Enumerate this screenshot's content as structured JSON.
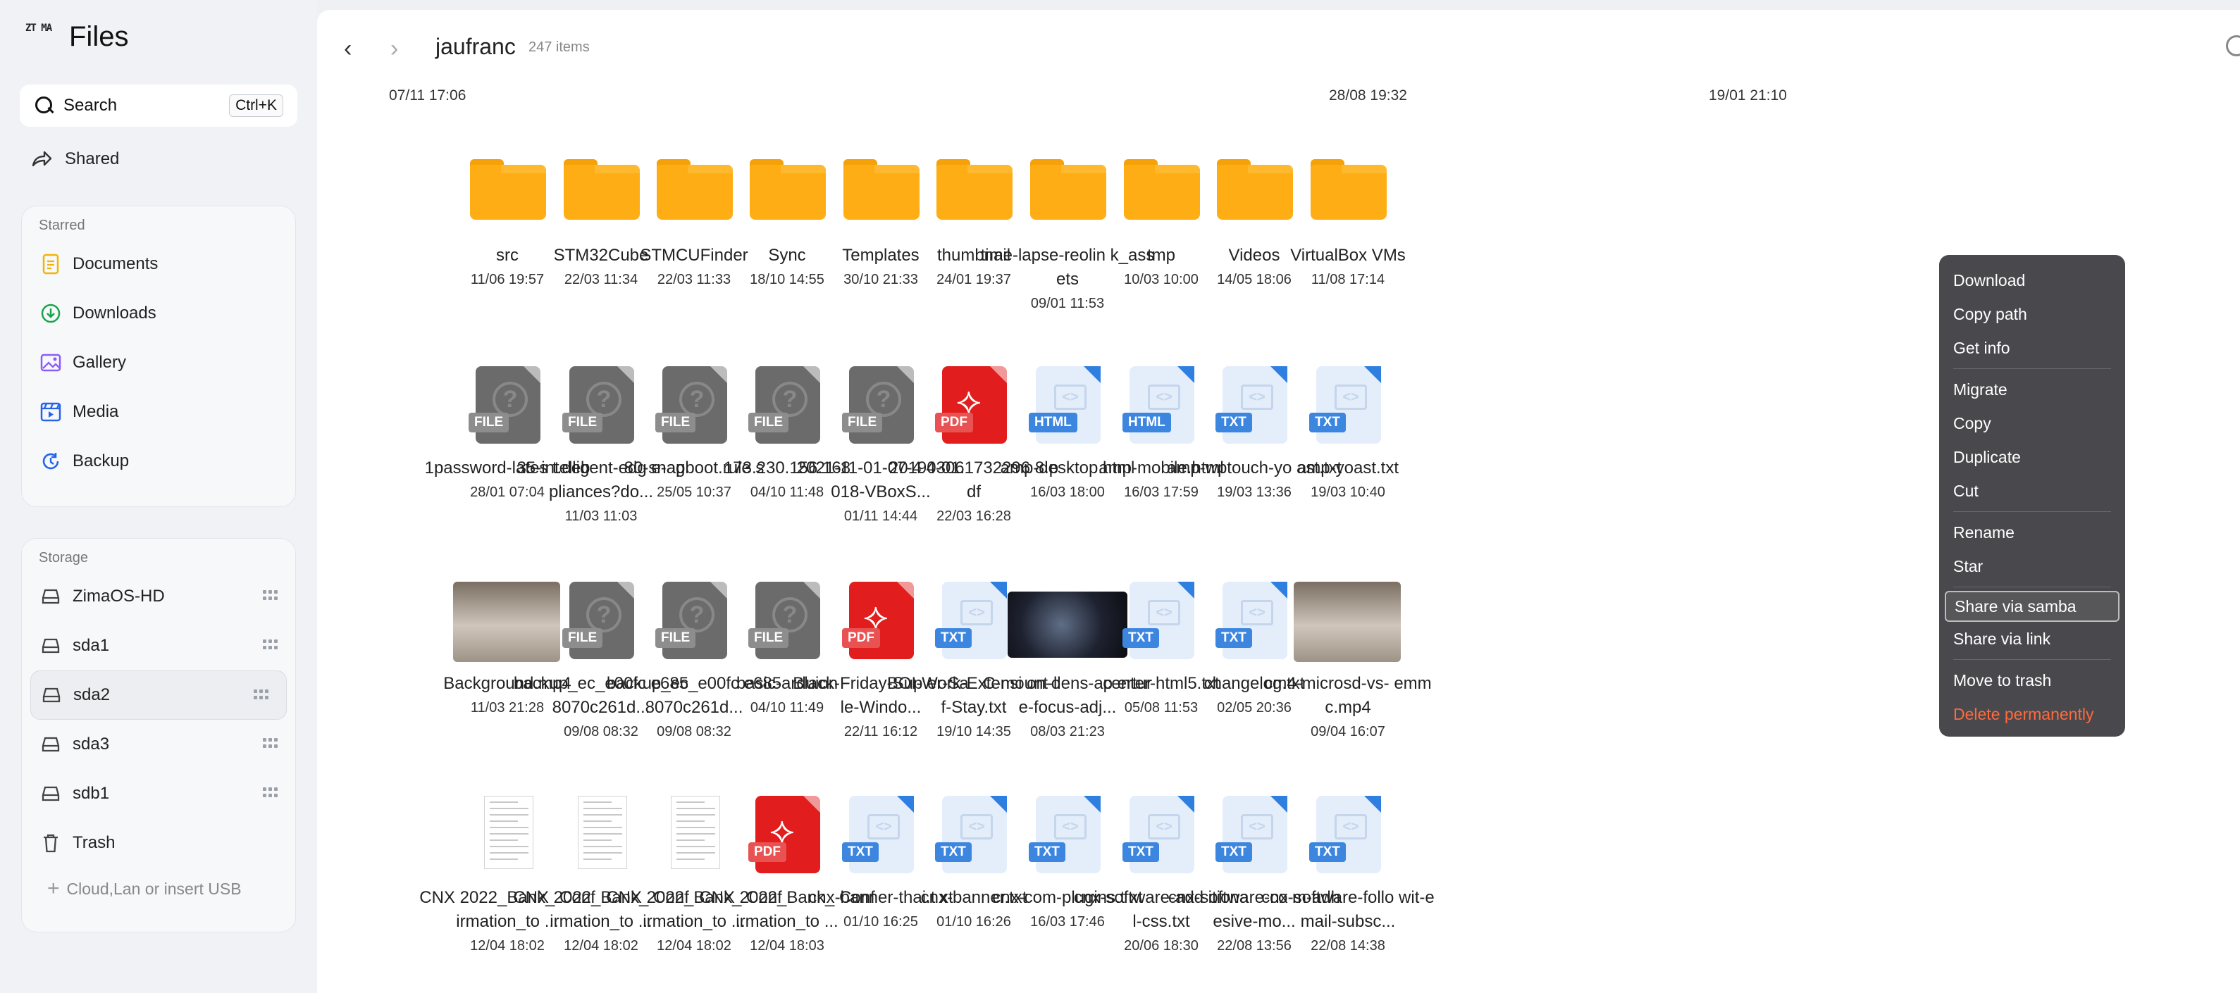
{
  "app": {
    "title": "Files",
    "logo_text": "ZT MA"
  },
  "search": {
    "label": "Search",
    "shortcut": "Ctrl+K"
  },
  "shared": {
    "label": "Shared"
  },
  "starred": {
    "title": "Starred",
    "items": [
      {
        "label": "Documents",
        "icon": "document-icon",
        "color": "#f4b400"
      },
      {
        "label": "Downloads",
        "icon": "download-icon",
        "color": "#1aa34a"
      },
      {
        "label": "Gallery",
        "icon": "image-icon",
        "color": "#8b5cf6"
      },
      {
        "label": "Media",
        "icon": "film-icon",
        "color": "#2563eb"
      },
      {
        "label": "Backup",
        "icon": "backup-icon",
        "color": "#2563eb"
      }
    ]
  },
  "storage": {
    "title": "Storage",
    "items": [
      {
        "label": "ZimaOS-HD"
      },
      {
        "label": "sda1"
      },
      {
        "label": "sda2"
      },
      {
        "label": "sda3"
      },
      {
        "label": "sdb1"
      },
      {
        "label": "Trash"
      }
    ],
    "add_label": "Cloud,Lan or insert USB"
  },
  "header": {
    "folder": "jaufranc",
    "count": "247 items"
  },
  "top_dates": [
    "07/11 17:06",
    "28/08 19:32",
    "19/01 21:10"
  ],
  "rows": [
    [
      {
        "name": "src",
        "date": "11/06 19:57",
        "type": "folder"
      },
      {
        "name": "STM32Cube",
        "date": "22/03 11:34",
        "type": "folder"
      },
      {
        "name": "STMCUFinder",
        "date": "22/03 11:33",
        "type": "folder"
      },
      {
        "name": "Sync",
        "date": "18/10 14:55",
        "type": "folder"
      },
      {
        "name": "Templates",
        "date": "30/10 21:33",
        "type": "folder"
      },
      {
        "name": "thumbnail",
        "date": "24/01 19:37",
        "type": "folder"
      },
      {
        "name": "time-lapse-reolin k_assets",
        "date": "09/01 11:53",
        "type": "folder"
      },
      {
        "name": "tmp",
        "date": "10/03 10:00",
        "type": "folder"
      },
      {
        "name": "Videos",
        "date": "14/05 18:06",
        "type": "folder"
      },
      {
        "name": "VirtualBox VMs",
        "date": "11/08 17:14",
        "type": "folder"
      }
    ],
    [
      {
        "name": "1password-lates t.deb",
        "date": "28/01 07:04",
        "type": "file",
        "badge": "FILE"
      },
      {
        "name": "35-intelligent-edg e-appliances?do...",
        "date": "11/03 11:03",
        "type": "file",
        "badge": "FILE"
      },
      {
        "name": "80-snagboot.rule s",
        "date": "25/05 10:37",
        "type": "file",
        "badge": "FILE"
      },
      {
        "name": "173.230.156.168",
        "date": "04/10 11:48",
        "type": "file",
        "badge": "FILE"
      },
      {
        "name": "2021-11-01-07-4 4-01.018-VBoxS...",
        "date": "01/11 14:44",
        "type": "file",
        "badge": "FILE"
      },
      {
        "name": "201903061732296 8.pdf",
        "date": "22/03 16:28",
        "type": "pdf",
        "badge": "PDF"
      },
      {
        "name": "amp-desktop.html",
        "date": "16/03 18:00",
        "type": "html",
        "badge": "HTML"
      },
      {
        "name": "amp-mobile.html",
        "date": "16/03 17:59",
        "type": "html",
        "badge": "HTML"
      },
      {
        "name": "amp-wptouch-yo ast.txt",
        "date": "19/03 13:36",
        "type": "txt",
        "badge": "TXT"
      },
      {
        "name": "amp-yoast.txt",
        "date": "19/03 10:40",
        "type": "txt",
        "badge": "TXT"
      }
    ],
    [
      {
        "name": "Background.mp4",
        "date": "11/03 21:28",
        "type": "photo"
      },
      {
        "name": "backup_ec_e00fc e6858070c261d...",
        "date": "09/08 08:32",
        "type": "file",
        "badge": "FILE"
      },
      {
        "name": "backup_ec_e00fc e6858070c261d...",
        "date": "09/08 08:32",
        "type": "file",
        "badge": "FILE"
      },
      {
        "name": "basic-arduion",
        "date": "04/10 11:49",
        "type": "file",
        "badge": "FILE"
      },
      {
        "name": "Black-Friday-Sup er-Sale-Windo...",
        "date": "22/11 16:12",
        "type": "pdf",
        "badge": "PDF"
      },
      {
        "name": "BOI-Work-Extensi on-of-Stay.txt",
        "date": "19/10 14:35",
        "type": "txt",
        "badge": "TXT"
      },
      {
        "name": "C-mount-llens-ap erture-focus-adj...",
        "date": "08/03 21:23",
        "type": "photo2"
      },
      {
        "name": "center-html5.txt",
        "date": "05/08 11:53",
        "type": "txt",
        "badge": "TXT"
      },
      {
        "name": "changelog.txt",
        "date": "02/05 20:36",
        "type": "txt",
        "badge": "TXT"
      },
      {
        "name": "cm4-microsd-vs- emmc.mp4",
        "date": "09/04 16:07",
        "type": "photo"
      }
    ],
    [
      {
        "name": "CNX 2022_Bank_ Confirmation_to ...",
        "date": "12/04 18:02",
        "type": "paper"
      },
      {
        "name": "CNX 2022_Bank_ Confirmation_to ...",
        "date": "12/04 18:02",
        "type": "paper"
      },
      {
        "name": "CNX 2022_Bank_ Confirmation_to ...",
        "date": "12/04 18:02",
        "type": "paper"
      },
      {
        "name": "CNX 2022_Bank_ Confirmation_to ...",
        "date": "12/04 18:03",
        "type": "pdf",
        "badge": "PDF"
      },
      {
        "name": "cnx-banner-thai.t xt",
        "date": "01/10 16:25",
        "type": "txt",
        "badge": "TXT"
      },
      {
        "name": "cnx-banner.txt",
        "date": "01/10 16:26",
        "type": "txt",
        "badge": "TXT"
      },
      {
        "name": "cnx-com-plugins.t xt",
        "date": "16/03 17:46",
        "type": "txt",
        "badge": "TXT"
      },
      {
        "name": "cnx-software-add itional-css.txt",
        "date": "20/06 18:30",
        "type": "txt",
        "badge": "TXT"
      },
      {
        "name": "cnx-software-co m-adhesive-mo...",
        "date": "22/08 13:56",
        "type": "txt",
        "badge": "TXT"
      },
      {
        "name": "cnx-software-follo wit-email-subsc...",
        "date": "22/08 14:38",
        "type": "txt",
        "badge": "TXT"
      }
    ]
  ],
  "context_menu": {
    "groups": [
      [
        "Download",
        "Copy path",
        "Get info"
      ],
      [
        "Migrate",
        "Copy",
        "Duplicate",
        "Cut"
      ],
      [
        "Rename",
        "Star"
      ],
      [
        "Share via samba",
        "Share via link"
      ],
      [
        "Move to trash",
        "Delete permanently"
      ]
    ],
    "highlighted": "Share via samba",
    "danger": "Delete permanently",
    "danger_color": "#ff6a3d"
  }
}
